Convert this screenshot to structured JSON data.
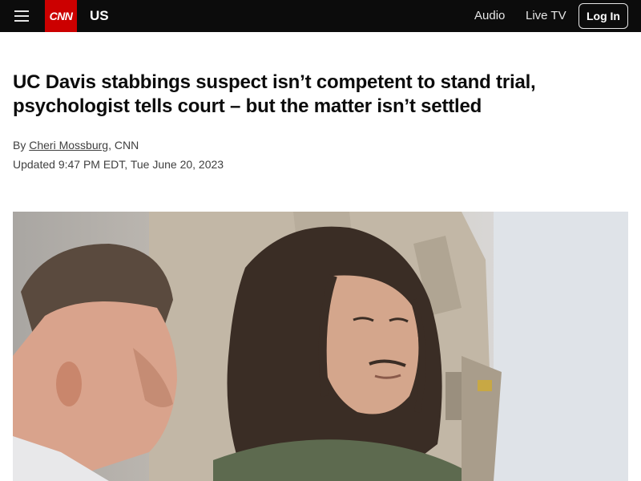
{
  "header": {
    "menu_icon": "hamburger-menu-icon",
    "logo_text": "CNN",
    "brand_color": "#cc0000",
    "section": "US",
    "nav": {
      "audio": "Audio",
      "live_tv": "Live TV",
      "login": "Log In"
    }
  },
  "article": {
    "headline": "UC Davis stabbings suspect isn’t competent to stand trial, psychologist tells court – but the matter isn’t settled",
    "byline_prefix": "By ",
    "author": "Cheri Mossburg",
    "byline_suffix": ", CNN",
    "updated": "Updated 9:47 PM EDT, Tue June 20, 2023"
  },
  "lead_image": {
    "description_icon": "courtroom-photo"
  }
}
